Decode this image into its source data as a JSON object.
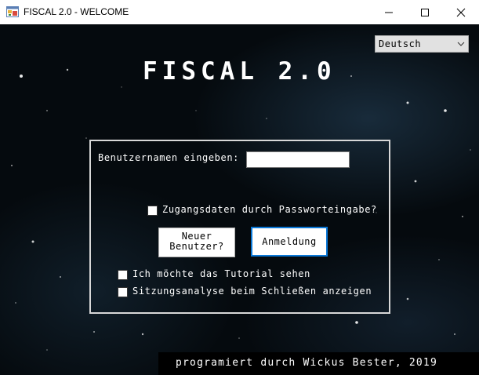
{
  "window": {
    "title": "FISCAL 2.0 - WELCOME",
    "icon": "app-window-icon"
  },
  "controls": {
    "minimize_icon": "minimize-icon",
    "maximize_icon": "maximize-icon",
    "close_icon": "close-icon"
  },
  "language": {
    "selected": "Deutsch",
    "icon": "chevron-down-icon"
  },
  "app_title": "FISCAL 2.0",
  "login": {
    "username_label": "Benutzernamen eingeben:",
    "username_value": "",
    "password_checkbox_label": "Zugangsdaten durch Passworteingabe?",
    "password_checked": false,
    "new_user_button": "Neuer Benutzer?",
    "login_button": "Anmeldung",
    "tutorial_checkbox_label": "Ich möchte das Tutorial sehen",
    "tutorial_checked": false,
    "session_checkbox_label": "Sitzungsanalyse beim Schließen anzeigen",
    "session_checked": false
  },
  "footer": {
    "credit": "programiert durch Wickus Bester, 2019"
  },
  "colors": {
    "background": "#050a0e",
    "text": "#ffffff",
    "accent_border": "#0a78d7"
  }
}
